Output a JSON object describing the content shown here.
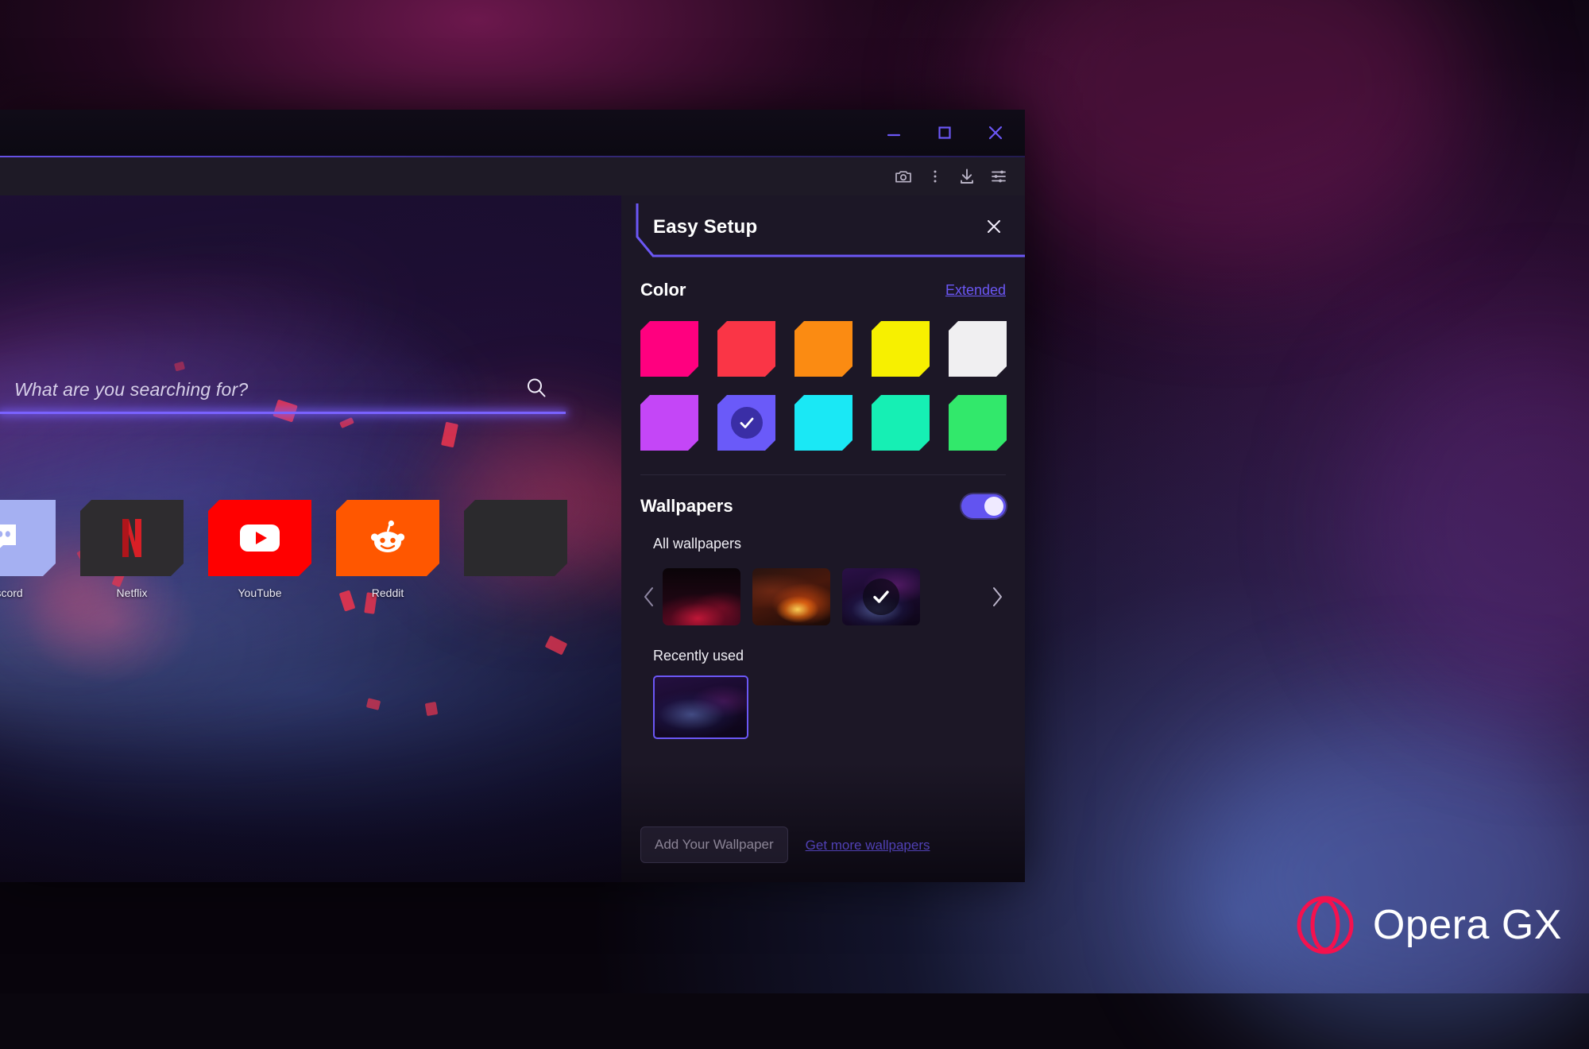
{
  "window_controls": {
    "minimize": "minimize-icon",
    "maximize": "maximize-icon",
    "close": "close-icon",
    "accent_color": "#6b57f5"
  },
  "toolbar": {
    "icons": [
      {
        "name": "snapshot-icon",
        "title": "Snapshot"
      },
      {
        "name": "more-vertical-icon",
        "title": "More"
      },
      {
        "name": "downloads-icon",
        "title": "Downloads"
      },
      {
        "name": "easy-setup-icon",
        "title": "Easy Setup"
      }
    ]
  },
  "speed_dial": {
    "tiles": [
      {
        "label": "Discord",
        "bg": "#a5b0f2",
        "icon": "discord-icon"
      },
      {
        "label": "Netflix",
        "bg": "#2e2c2f",
        "icon": "netflix-icon"
      },
      {
        "label": "YouTube",
        "bg": "#ff0000",
        "icon": "youtube-icon"
      },
      {
        "label": "Reddit",
        "bg": "#ff5700",
        "icon": "reddit-icon"
      },
      {
        "label": "",
        "bg": "#2b2a2d",
        "icon": "blank-tile-icon"
      }
    ]
  },
  "search": {
    "placeholder": "What are you searching for?",
    "value": "",
    "icon": "search-icon",
    "underline_color": "#7a62ff"
  },
  "panel": {
    "title": "Easy Setup",
    "close_icon": "close-icon",
    "accent_color": "#6b57f5",
    "color_section": {
      "title": "Color",
      "extended_label": "Extended",
      "swatches": [
        {
          "name": "pink",
          "hex": "#ff007f",
          "selected": false
        },
        {
          "name": "red",
          "hex": "#fa3546",
          "selected": false
        },
        {
          "name": "orange",
          "hex": "#fb8b12",
          "selected": false
        },
        {
          "name": "yellow",
          "hex": "#f7f000",
          "selected": false
        },
        {
          "name": "white",
          "hex": "#f0eff1",
          "selected": false
        },
        {
          "name": "violet",
          "hex": "#c446f7",
          "selected": false
        },
        {
          "name": "purple",
          "hex": "#6a5af9",
          "selected": true
        },
        {
          "name": "cyan",
          "hex": "#1ae8f5",
          "selected": false
        },
        {
          "name": "turquoise",
          "hex": "#16efb4",
          "selected": false
        },
        {
          "name": "green",
          "hex": "#32e86b",
          "selected": false
        }
      ],
      "selected_check_bg": "#3a2ea6"
    },
    "wallpapers_section": {
      "title": "Wallpapers",
      "toggle_on": true,
      "toggle_color": "#6254f0",
      "all_label": "All wallpapers",
      "prev_icon": "chevron-left-icon",
      "next_icon": "chevron-right-icon",
      "thumbnails": [
        {
          "name": "red-sparks-wallpaper",
          "selected": false
        },
        {
          "name": "fire-swirl-wallpaper",
          "selected": false
        },
        {
          "name": "purple-wave-wallpaper",
          "selected": true
        }
      ],
      "recent_label": "Recently used",
      "recent_thumbnails": [
        {
          "name": "purple-wave-wallpaper",
          "selected": true
        }
      ],
      "add_wallpaper_label": "Add Your Wallpaper",
      "get_more_label": "Get more wallpapers"
    }
  },
  "branding": {
    "name": "Opera GX",
    "logo_icon": "opera-gx-logo-icon",
    "logo_color": "#f5114e"
  }
}
